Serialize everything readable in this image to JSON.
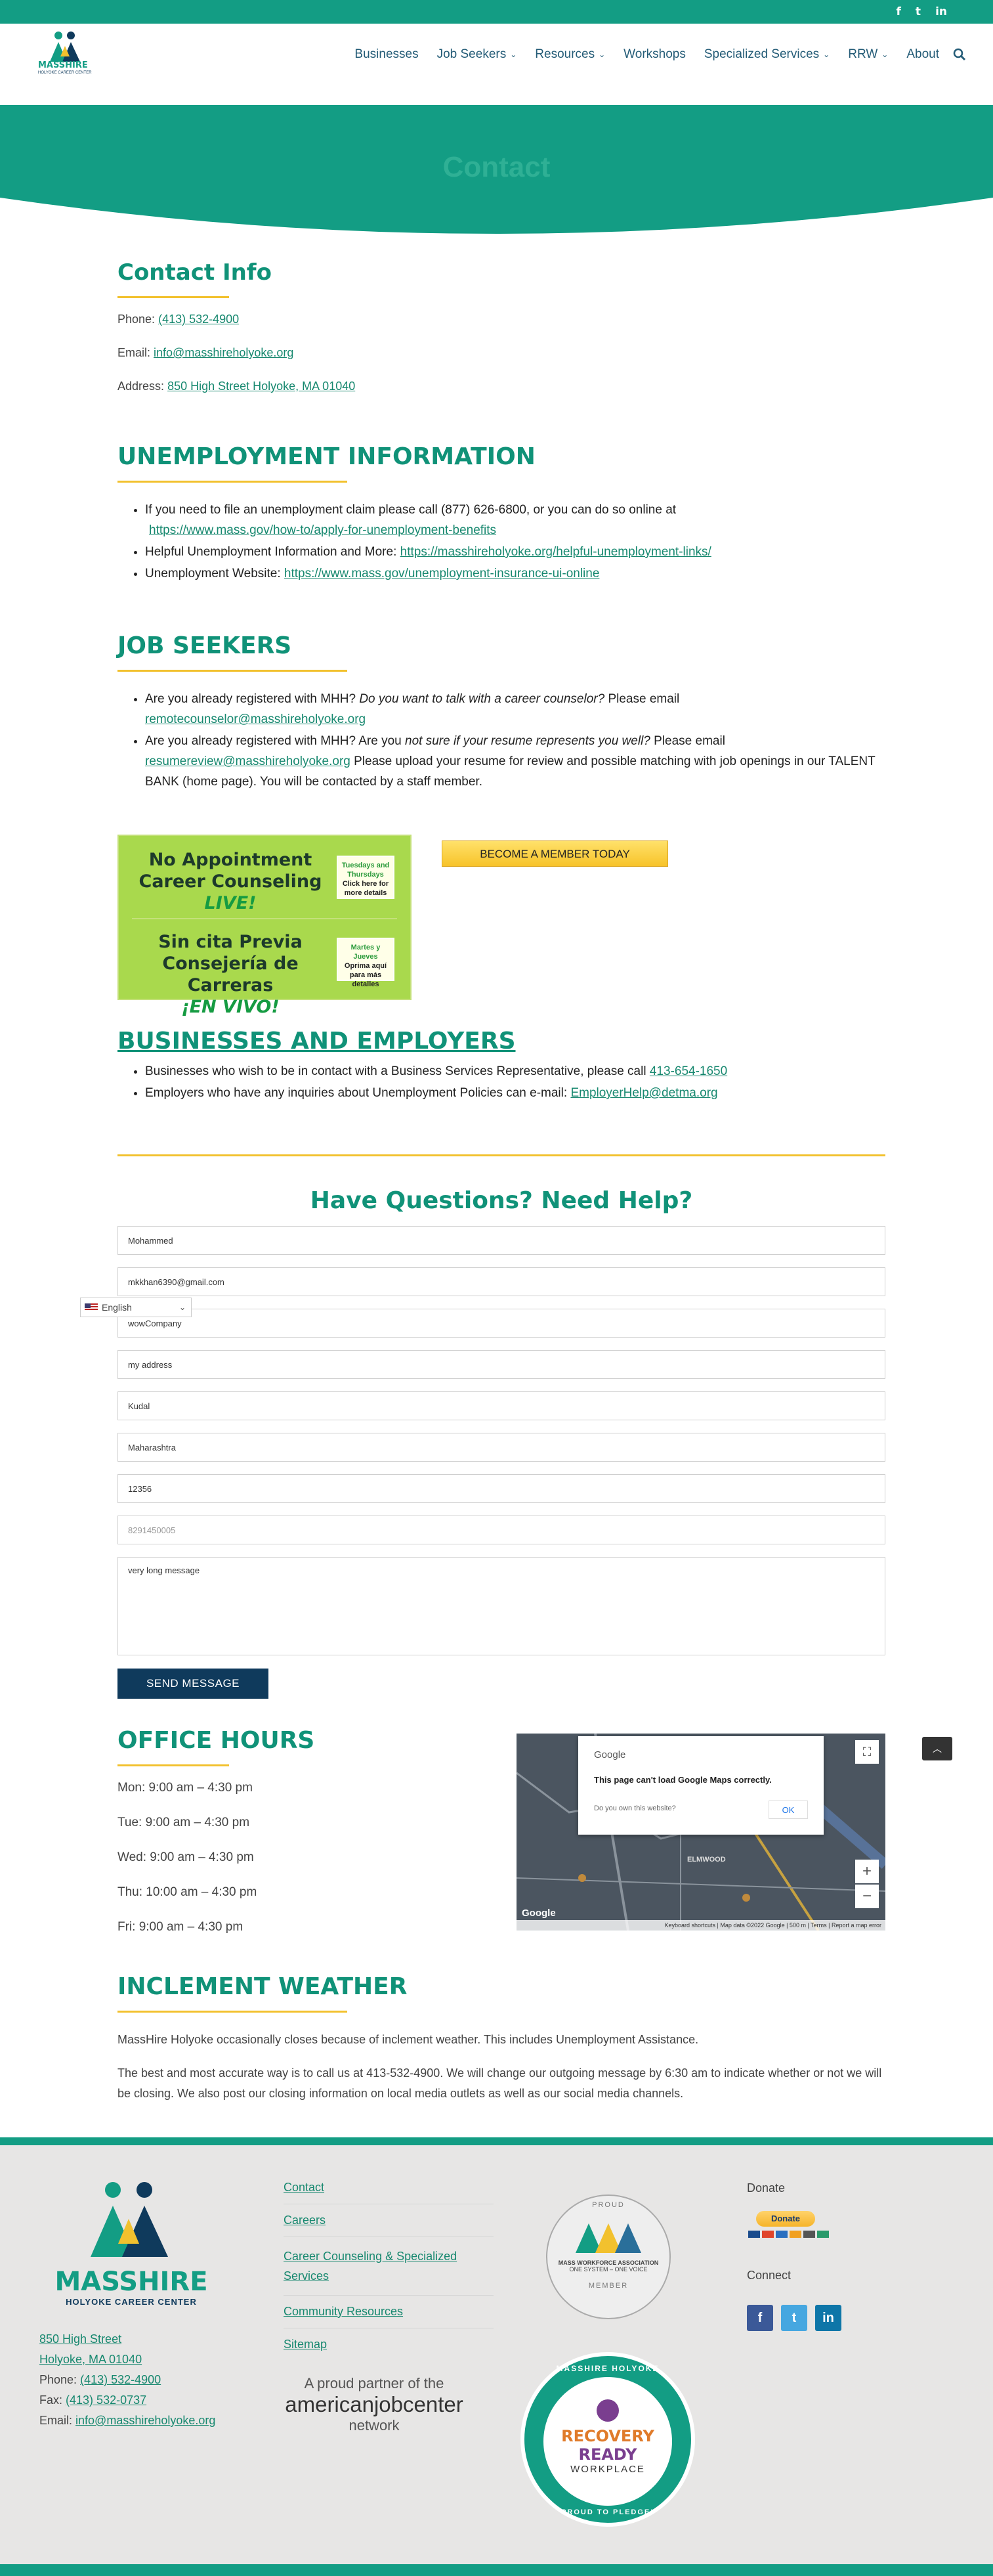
{
  "social": {
    "facebook": "f",
    "twitter": "t",
    "linkedin": "in"
  },
  "nav": {
    "items": [
      {
        "label": "Businesses",
        "dropdown": false
      },
      {
        "label": "Job Seekers",
        "dropdown": true
      },
      {
        "label": "Resources",
        "dropdown": true
      },
      {
        "label": "Workshops",
        "dropdown": false
      },
      {
        "label": "Specialized Services",
        "dropdown": true
      },
      {
        "label": "RRW",
        "dropdown": true
      },
      {
        "label": "About",
        "dropdown": false
      }
    ],
    "chevron": "⌄",
    "search_icon": "search-icon"
  },
  "logo": {
    "brand": "MASSHIRE",
    "sub": "HOLYOKE CAREER CENTER"
  },
  "hero": {
    "title": "Contact"
  },
  "contact": {
    "heading": "Contact Info",
    "phone_label": "Phone:",
    "phone": "(413) 532-4900",
    "email_label": "Email:",
    "email": "info@masshireholyoke.org",
    "address_label": "Address:",
    "address": "850 High Street Holyoke, MA 01040"
  },
  "unemployment": {
    "heading": "UNEMPLOYMENT  INFORMATION",
    "item1_text": "If you need to file an unemployment claim please call (877) 626-6800, or you can do so online at",
    "item1_link": "https://www.mass.gov/how-to/apply-for-unemployment-benefits",
    "item2_text": "Helpful Unemployment Information and More:",
    "item2_link": "https://masshireholyoke.org/helpful-unemployment-links/",
    "item3_text": "Unemployment Website:",
    "item3_link": "https://www.mass.gov/unemployment-insurance-ui-online"
  },
  "job_seekers": {
    "heading": "JOB SEEKERS",
    "item1_a": "Are you already registered with MHH?",
    "item1_b": "Do you want to talk with a career counselor?",
    "item1_c": "Please email",
    "item1_link": "remotecounselor@masshireholyoke.org",
    "item2_a": "Are you already registered with MHH? Are you",
    "item2_b": "not sure if your resume represents you well?",
    "item2_c": "Please email",
    "item2_link": "resumereview@masshireholyoke.org",
    "item2_d": "Please upload your resume for review and possible matching with job openings in our TALENT BANK (home page). You will be contacted by a staff member.",
    "banner": {
      "en_line1": "No Appointment",
      "en_line2": "Career Counseling",
      "en_live": "LIVE!",
      "en_tag1": "Tuesdays and Thursdays",
      "en_tag2": "Click here for more details",
      "es_line1": "Sin cita Previa",
      "es_line2": "Consejería de Carreras",
      "es_live": "¡EN VIVO!",
      "es_tag1": "Martes y Jueves",
      "es_tag2": "Oprima aquí para más detalles"
    },
    "member_button": "BECOME A MEMBER TODAY"
  },
  "businesses": {
    "heading": "BUSINESSES AND EMPLOYERS",
    "item1_text": "Businesses who wish to be in contact with a Business Services  Representative, please call",
    "item1_link": "413-654-1650",
    "item2_text": "Employers who have any inquiries about Unemployment Policies can e-mail:",
    "item2_link": "EmployerHelp@detma.org"
  },
  "form": {
    "heading": "Have Questions? Need Help?",
    "name": "Mohammed",
    "email": "mkkhan6390@gmail.com",
    "company": "wowCompany",
    "address": "my address",
    "city": "Kudal",
    "state": "Maharashtra",
    "zip": "12356",
    "phone_placeholder": "8291450005",
    "message": "very long message",
    "submit": "SEND MESSAGE"
  },
  "language": {
    "selected": "English",
    "chevron": "⌄"
  },
  "office_hours": {
    "heading": "OFFICE HOURS",
    "rows": [
      "Mon: 9:00 am – 4:30 pm",
      "Tue: 9:00 am – 4:30 pm",
      "Wed: 9:00 am – 4:30 pm",
      "Thu: 10:00 am – 4:30 pm",
      "Fri: 9:00 am – 4:30 pm"
    ]
  },
  "map": {
    "brand": "Google",
    "message": "This page can't load Google Maps correctly.",
    "question": "Do you own this website?",
    "ok": "OK",
    "place_label": "ELMWOOD",
    "footer": "Keyboard shortcuts | Map data ©2022 Google | 500 m | Terms | Report a map error",
    "logo": "Google"
  },
  "weather": {
    "heading": "INCLEMENT WEATHER",
    "p1": "MassHire Holyoke occasionally closes because of inclement weather. This includes Unemployment Assistance.",
    "p2": "The best and most accurate way is to call us at 413-532-4900. We will change our outgoing message by 6:30 am to indicate whether or not we will be closing. We also post our closing information on local media outlets as well as our social media channels."
  },
  "footer": {
    "brand": "MASSHIRE",
    "brand_sub": "HOLYOKE CAREER CENTER",
    "address1": "850 High Street",
    "address2": "Holyoke, MA 01040",
    "phone_label": "Phone:",
    "phone": "(413) 532-4900",
    "fax_label": "Fax:",
    "fax": "(413) 532-0737",
    "email_label": "Email:",
    "email": "info@masshireholyoke.org",
    "menu": [
      "Contact",
      "Careers",
      "Career Counseling & Specialized Services",
      "Community Resources",
      "Sitemap"
    ],
    "partner_line1": "A proud partner of the",
    "partner_brand": "americanjobcenter",
    "partner_line2": "network",
    "mwa_top": "PROUD",
    "mwa_name": "MASS WORKFORCE ASSOCIATION",
    "mwa_tag": "ONE SYSTEM – ONE VOICE",
    "mwa_bottom": "MEMBER",
    "rrw_top": "MASSHIRE HOLYOKE",
    "rrw_1": "RECOVERY",
    "rrw_2": "READY",
    "rrw_3": "WORKPLACE",
    "rrw_bottom": "PROUD TO PLEDGE!",
    "donate_label": "Donate",
    "donate_button": "Donate",
    "connect_label": "Connect"
  }
}
